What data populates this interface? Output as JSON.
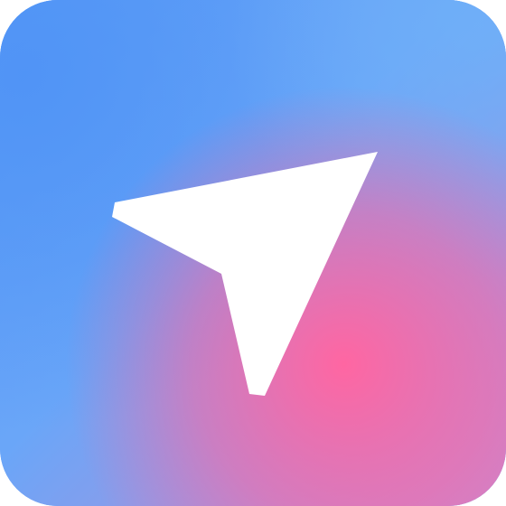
{
  "app_icon": {
    "icon": "navigation-arrow-icon",
    "colors": {
      "blue": "#5a9bf7",
      "light_blue": "#6fb0f8",
      "pink": "#ff66a2",
      "lavender": "#c58ad1",
      "arrow": "#ffffff"
    }
  }
}
